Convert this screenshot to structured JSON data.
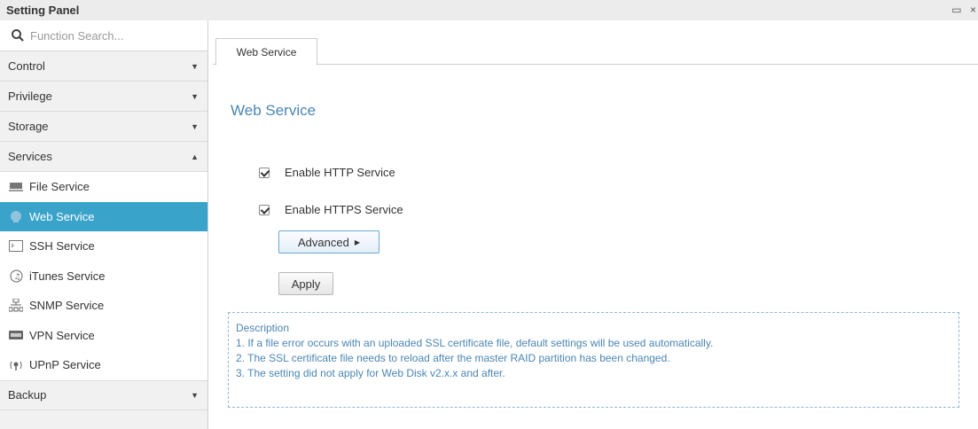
{
  "window": {
    "title": "Setting Panel",
    "buttons": [
      "▭",
      "×"
    ]
  },
  "sidebar": {
    "search_placeholder": "Function Search...",
    "categories": [
      {
        "label": "Control",
        "arrow": "▼"
      },
      {
        "label": "Privilege",
        "arrow": "▼"
      },
      {
        "label": "Storage",
        "arrow": "▼"
      },
      {
        "label": "Services",
        "arrow": "▲"
      }
    ],
    "services": [
      {
        "label": "File Service",
        "icon": "folder-icon"
      },
      {
        "label": "Web Service",
        "icon": "globe-icon",
        "active": true
      },
      {
        "label": "SSH Service",
        "icon": "terminal-icon"
      },
      {
        "label": "iTunes Service",
        "icon": "music-icon"
      },
      {
        "label": "SNMP Service",
        "icon": "network-icon"
      },
      {
        "label": "VPN Service",
        "icon": "vpn-icon"
      },
      {
        "label": "UPnP Service",
        "icon": "upnp-icon"
      }
    ],
    "backup": {
      "label": "Backup",
      "arrow": "▼"
    }
  },
  "main": {
    "tab": "Web Service",
    "title": "Web Service",
    "http_label": "Enable HTTP Service",
    "https_label": "Enable HTTPS Service",
    "http_checked": true,
    "https_checked": true,
    "advanced_label": "Advanced",
    "advanced_caret": "▶",
    "apply_label": "Apply",
    "description": {
      "heading": "Description",
      "lines": [
        "1. If a file error occurs with an uploaded SSL certificate file, default settings will be used automatically.",
        "2. The SSL certificate file needs to reload after the master RAID partition has been changed.",
        "3. The setting did not apply for Web Disk v2.x.x and after."
      ]
    }
  },
  "colors": {
    "accent": "#3aa3c9",
    "title_blue": "#4b86b4"
  }
}
